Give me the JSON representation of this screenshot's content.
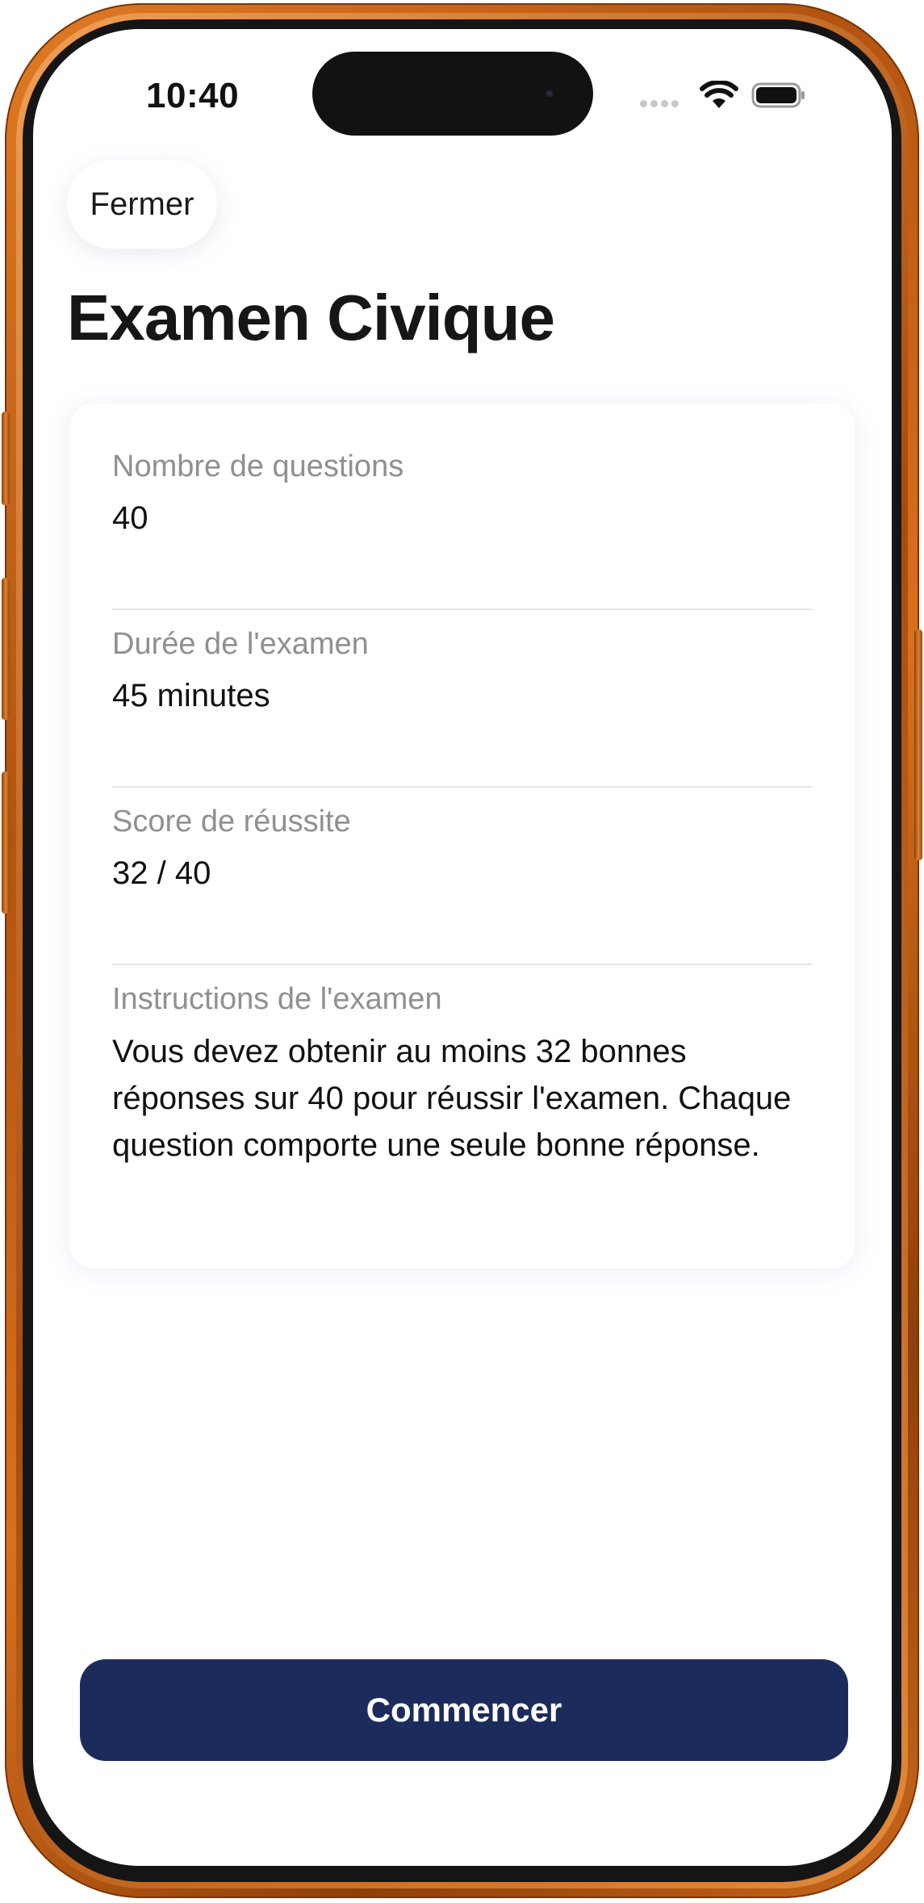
{
  "status_bar": {
    "time": "10:40",
    "icons": [
      "cellular-icon",
      "wifi-icon",
      "battery-icon"
    ]
  },
  "header": {
    "close_label": "Fermer",
    "title": "Examen Civique"
  },
  "exam_info": [
    {
      "label": "Nombre de questions",
      "value": "40"
    },
    {
      "label": "Durée de l'examen",
      "value": "45 minutes"
    },
    {
      "label": "Score de réussite",
      "value": "32 / 40"
    },
    {
      "label": "Instructions de l'examen",
      "value": "Vous devez obtenir au moins 32 bonnes réponses sur 40 pour réussir l'examen. Chaque question comporte une seule bonne réponse."
    }
  ],
  "footer": {
    "start_label": "Commencer"
  },
  "colors": {
    "primary": "#1b2c5c",
    "frame": "#c9681b",
    "label_gray": "#8f8f94"
  }
}
